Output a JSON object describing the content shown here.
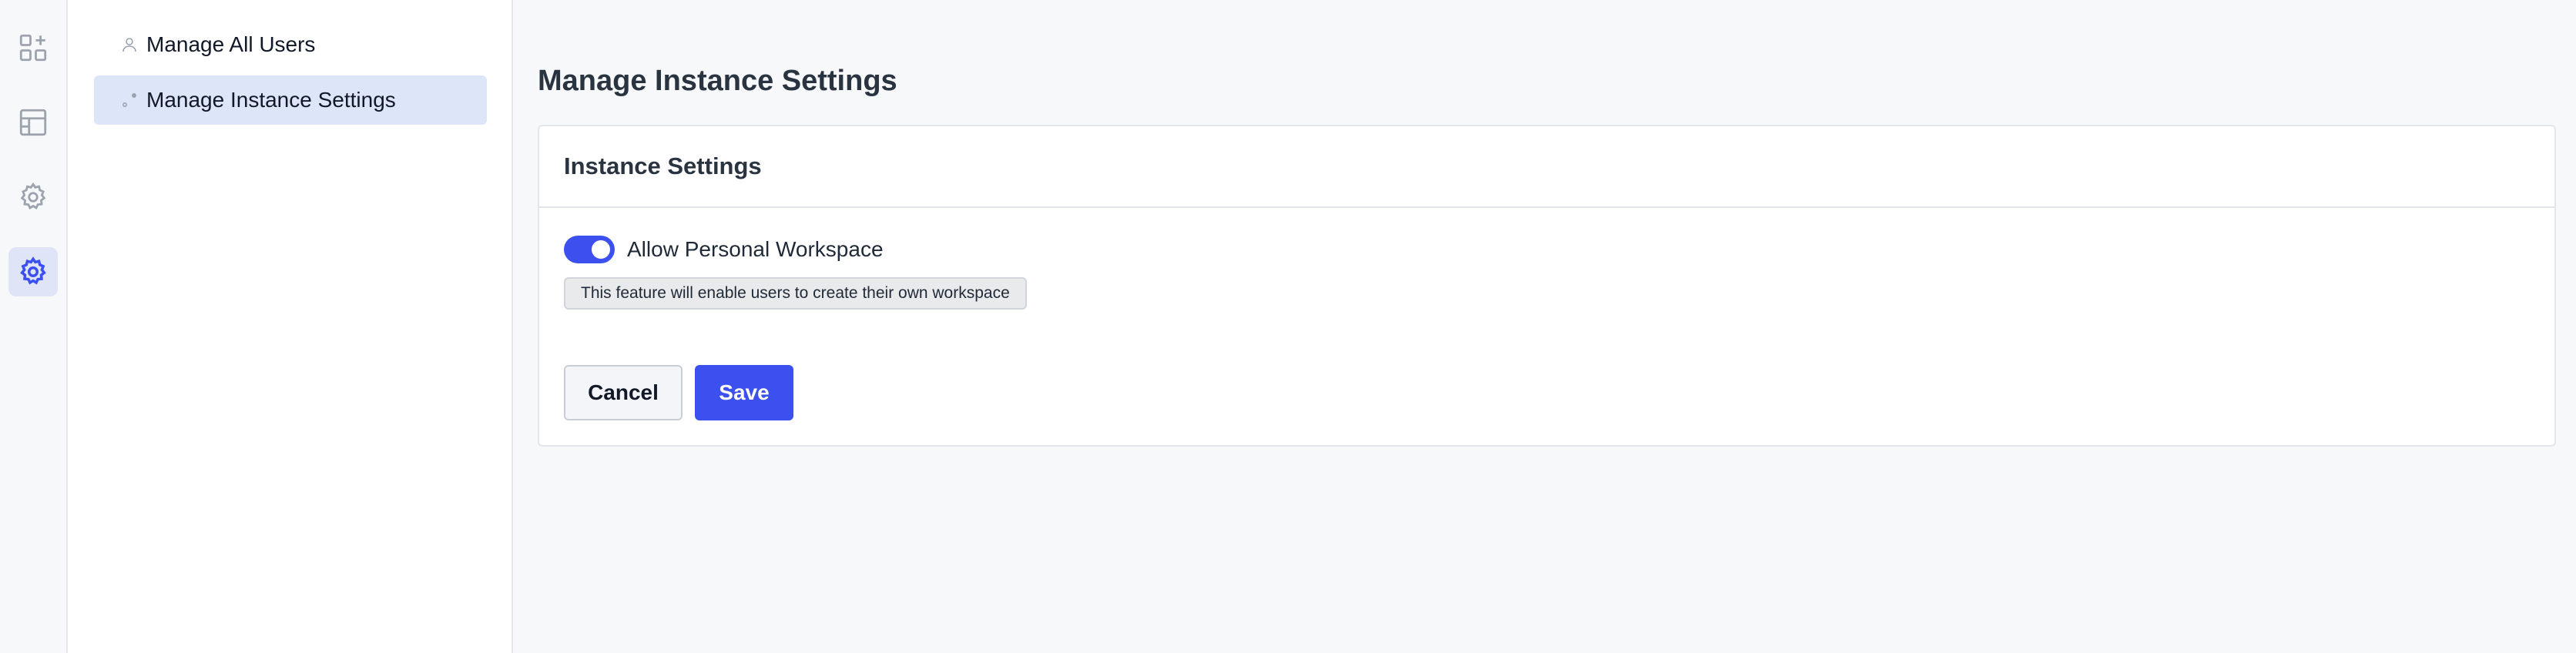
{
  "rail": {
    "items": [
      {
        "icon": "apps-add-icon"
      },
      {
        "icon": "layout-icon"
      },
      {
        "icon": "gear-icon"
      },
      {
        "icon": "gear-icon",
        "active": true
      }
    ]
  },
  "subnav": {
    "items": [
      {
        "label": "Manage All Users",
        "icon": "user-icon"
      },
      {
        "label": "Manage Instance Settings",
        "icon": "nodes-icon",
        "active": true
      }
    ]
  },
  "main": {
    "title": "Manage Instance Settings",
    "card": {
      "title": "Instance Settings",
      "toggle_label": "Allow Personal Workspace",
      "toggle_on": true,
      "hint": "This feature will enable users to create their own workspace",
      "cancel_label": "Cancel",
      "save_label": "Save"
    }
  },
  "colors": {
    "accent": "#3b50ef",
    "active_bg": "#dde5f8",
    "icon_gray": "#9ca3af"
  }
}
